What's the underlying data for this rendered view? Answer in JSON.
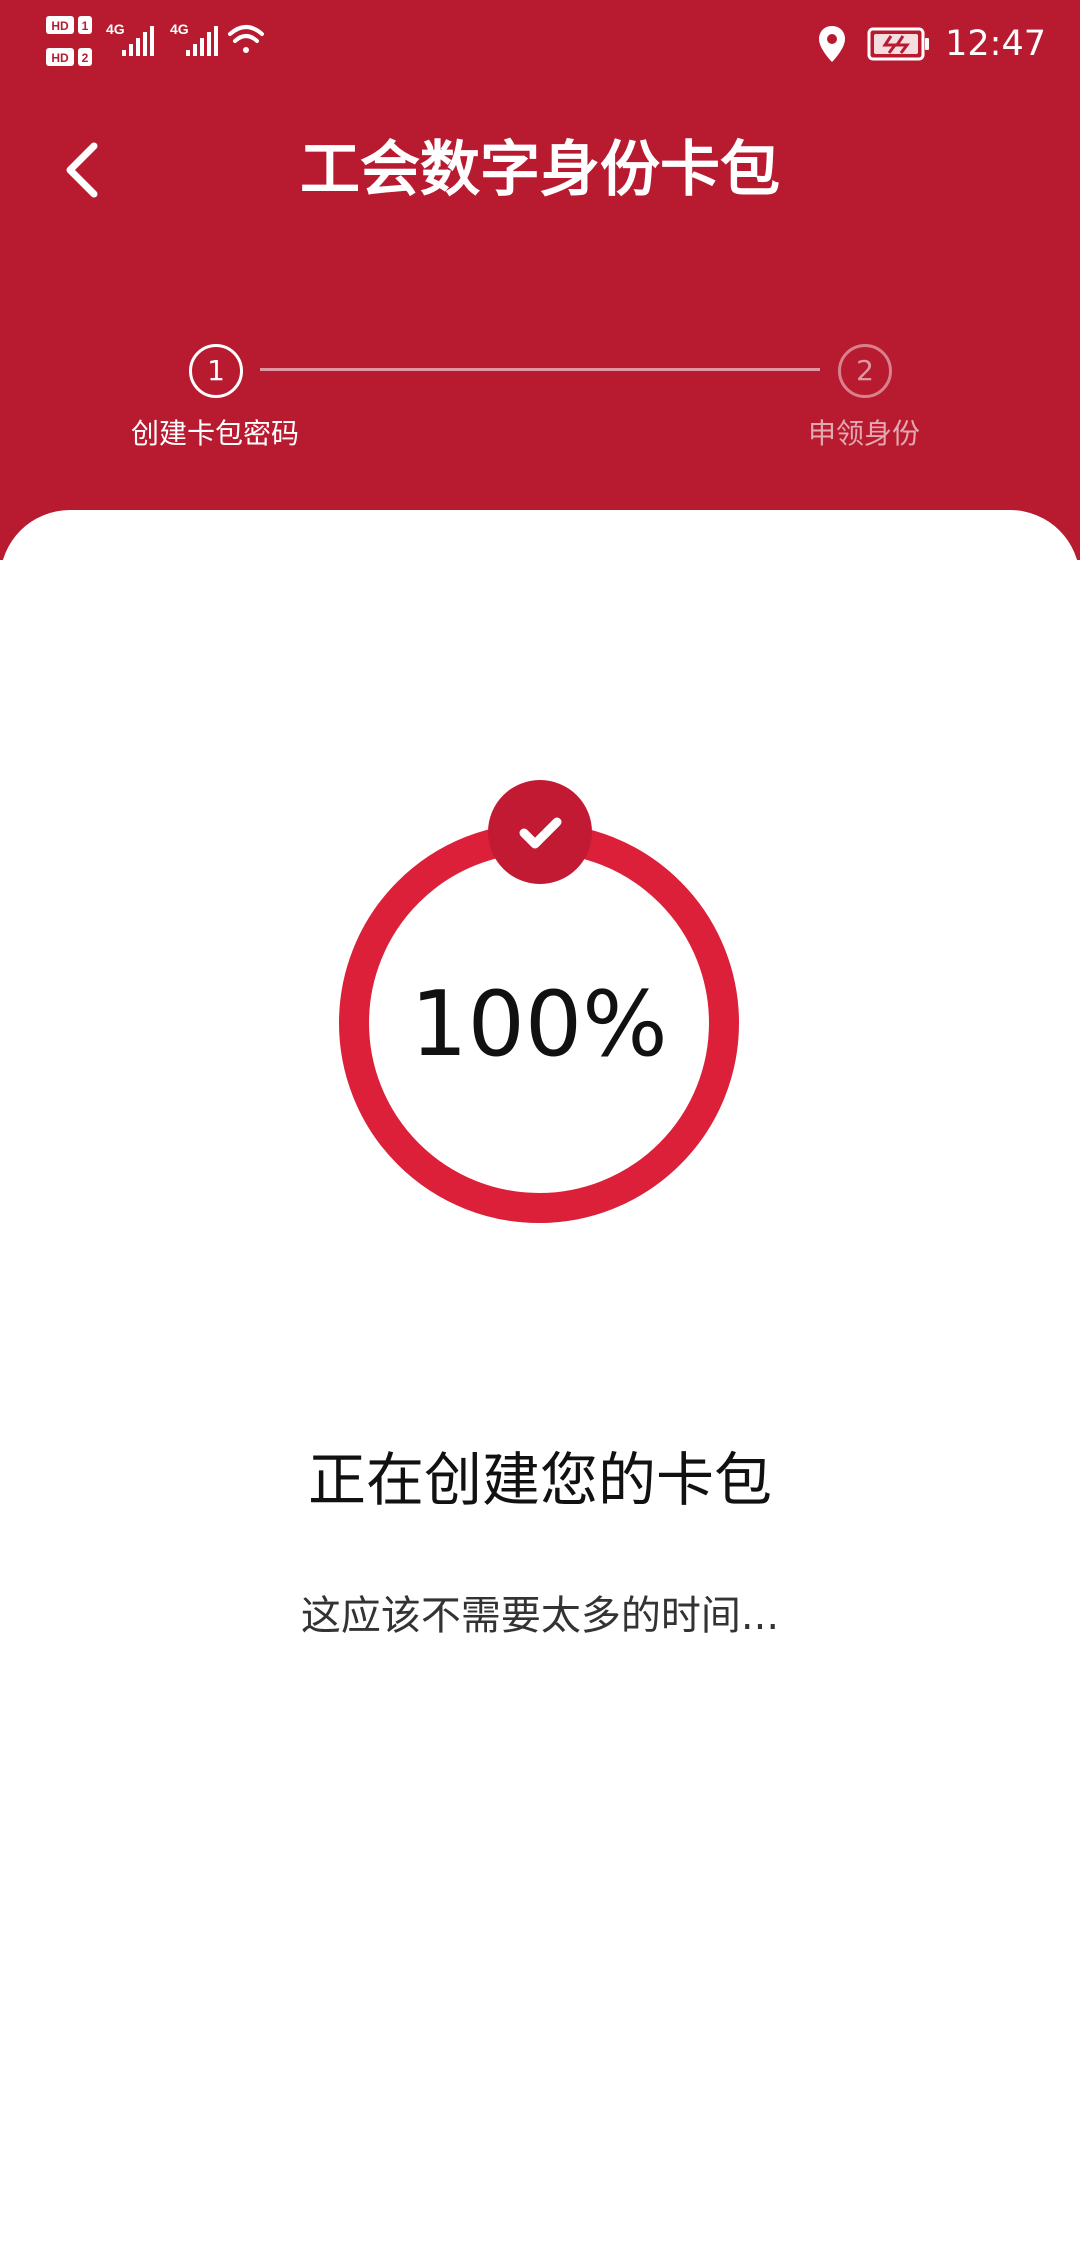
{
  "status_bar": {
    "time": "12:47",
    "sim1_label": "HD 1",
    "sim2_label": "HD 2",
    "network1": "4G",
    "network2": "4G",
    "icons": [
      "signal-icon",
      "wifi-icon",
      "location-icon",
      "battery-icon"
    ]
  },
  "header": {
    "title": "工会数字身份卡包",
    "back_icon": "chevron-left-icon"
  },
  "stepper": {
    "steps": [
      {
        "number": "1",
        "label": "创建卡包密码",
        "active": true
      },
      {
        "number": "2",
        "label": "申领身份",
        "active": false
      }
    ]
  },
  "progress": {
    "percent_text": "100%",
    "value": 1.0,
    "badge_icon": "check-icon"
  },
  "message": {
    "title": "正在创建您的卡包",
    "subtitle": "这应该不需要太多的时间..."
  },
  "colors": {
    "brand_red": "#b81b30",
    "ring_red": "#dc203a",
    "badge_red": "#c21a33",
    "text_dark": "#111111"
  }
}
